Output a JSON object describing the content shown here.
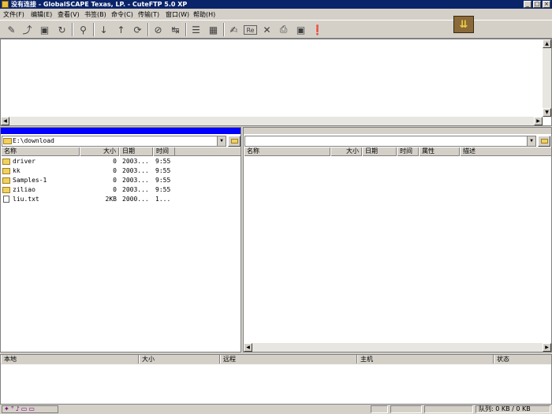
{
  "window": {
    "title": "没有连接 - GlobalSCAPE Texas, LP. - CuteFTP 5.0 XP"
  },
  "menu": [
    "文件(F)",
    "编辑(E)",
    "查看(V)",
    "书签(B)",
    "命令(C)",
    "传输(T)",
    "窗口(W)",
    "帮助(H)"
  ],
  "toolbar": {
    "icons": [
      "connect-icon",
      "disconnect-icon",
      "site-manager-icon",
      "reconnect-icon",
      "find-icon",
      "download-icon",
      "upload-icon",
      "refresh-icon",
      "stop-icon",
      "transfer-icon",
      "list-view-icon",
      "details-view-icon",
      "edit-icon",
      "rename-icon",
      "delete-icon",
      "print-icon",
      "snapshot-icon",
      "help-icon"
    ]
  },
  "local": {
    "path": "E:\\download",
    "columns": [
      "名称",
      "大小",
      "日期",
      "时间"
    ],
    "files": [
      {
        "name": "driver",
        "size": "0",
        "date": "2003...",
        "time": "9:55",
        "type": "folder"
      },
      {
        "name": "kk",
        "size": "0",
        "date": "2003...",
        "time": "9:55",
        "type": "folder"
      },
      {
        "name": "Samples-1",
        "size": "0",
        "date": "2003...",
        "time": "9:55",
        "type": "folder"
      },
      {
        "name": "ziliao",
        "size": "0",
        "date": "2003...",
        "time": "9:55",
        "type": "folder"
      },
      {
        "name": "liu.txt",
        "size": "2KB",
        "date": "2000...",
        "time": "1...",
        "type": "file"
      }
    ]
  },
  "remote": {
    "path": "",
    "columns": [
      "名称",
      "大小",
      "日期",
      "时间",
      "属性",
      "描述"
    ]
  },
  "queue": {
    "columns": [
      "本地",
      "大小",
      "远程",
      "主机",
      "状态"
    ]
  },
  "status": {
    "queue_text": "队列: 0 KB / 0 KB"
  },
  "colors": {
    "titlebar": "#0a246a",
    "active_pane": "#0000ff",
    "inactive_pane": "#d4d0c8",
    "chrome": "#d4d0c8"
  }
}
